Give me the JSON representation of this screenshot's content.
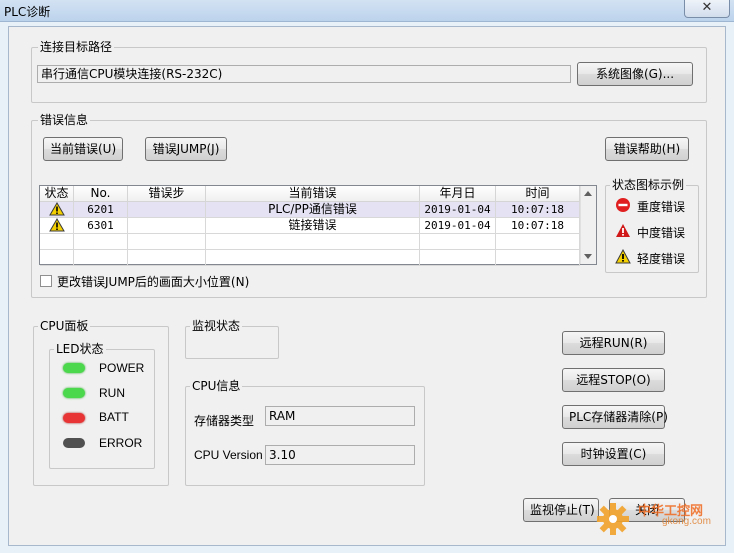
{
  "window": {
    "title": "PLC诊断",
    "close_glyph": "✕"
  },
  "connection": {
    "group_label": "连接目标路径",
    "path_value": "串行通信CPU模块连接(RS-232C)",
    "system_image_button": "系统图像(G)..."
  },
  "error_info": {
    "group_label": "错误信息",
    "current_error_button": "当前错误(U)",
    "error_jump_button": "错误JUMP(J)",
    "error_help_button": "错误帮助(H)",
    "columns": [
      "状态",
      "No.",
      "错误步",
      "当前错误",
      "年月日",
      "时间"
    ],
    "rows": [
      {
        "status": "warning-icon",
        "no": "6201",
        "step": "",
        "error": "PLC/PP通信错误",
        "date": "2019-01-04",
        "time": "10:07:18",
        "selected": true
      },
      {
        "status": "warning-icon",
        "no": "6301",
        "step": "",
        "error": "链接错误",
        "date": "2019-01-04",
        "time": "10:07:18",
        "selected": false
      }
    ],
    "resize_checkbox_label": "更改错误JUMP后的画面大小位置(N)",
    "resize_checkbox_checked": false
  },
  "legend": {
    "group_label": "状态图标示例",
    "items": [
      {
        "icon": "major-error-icon",
        "label": "重度错误",
        "color": "#e02020"
      },
      {
        "icon": "moderate-error-icon",
        "label": "中度错误",
        "color": "#d01818"
      },
      {
        "icon": "minor-error-icon",
        "label": "轻度错误",
        "color": "#f5d000"
      }
    ]
  },
  "cpu_panel": {
    "group_label": "CPU面板",
    "led_group_label": "LED状态",
    "leds": [
      {
        "label": "POWER",
        "color": "#4cd84c"
      },
      {
        "label": "RUN",
        "color": "#4cd84c"
      },
      {
        "label": "BATT",
        "color": "#e83434"
      },
      {
        "label": "ERROR",
        "color": "#505050"
      }
    ]
  },
  "monitor_status": {
    "group_label": "监视状态"
  },
  "cpu_info": {
    "group_label": "CPU信息",
    "memory_type_label": "存储器类型",
    "memory_type_value": "RAM",
    "cpu_version_label": "CPU Version",
    "cpu_version_value": "3.10"
  },
  "actions": {
    "remote_run": "远程RUN(R)",
    "remote_stop": "远程STOP(O)",
    "plc_memory_clear": "PLC存储器清除(P)",
    "clock_setting": "时钟设置(C)",
    "stop_monitor": "监视停止(T)",
    "close": "关闭"
  },
  "watermark": {
    "text": "中华工控网",
    "subtext": "gkong.com"
  }
}
